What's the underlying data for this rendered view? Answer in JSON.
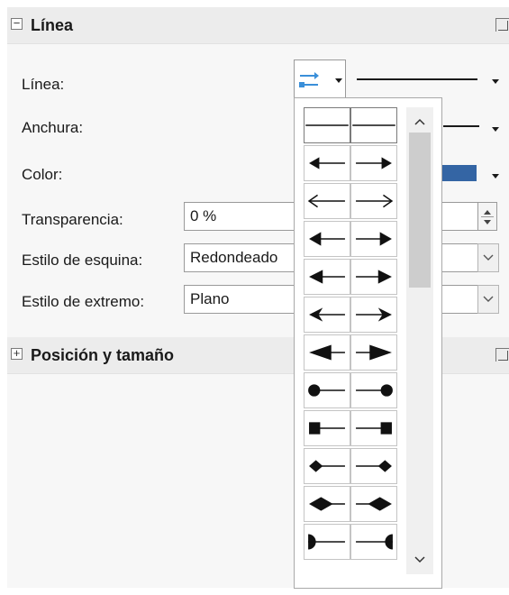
{
  "section_line": {
    "title": "Línea"
  },
  "labels": {
    "line": "Línea:",
    "width": "Anchura:",
    "color": "Color:",
    "transparency": "Transparencia:",
    "corner_style": "Estilo de esquina:",
    "cap_style": "Estilo de extremo:"
  },
  "fields": {
    "transparency": "0 %",
    "corner_style": "Redondeado",
    "cap_style": "Plano"
  },
  "colors": {
    "line_color": "#3465a4",
    "arrow_icon": "#3a8fd9"
  },
  "arrow_styles": [
    "none-left",
    "none-right",
    "arrow-left",
    "arrow-right",
    "line-arrow-left",
    "line-arrow-right",
    "arrow-short-left",
    "arrow-short-right",
    "triangle-left",
    "triangle-right",
    "concave-left",
    "concave-right",
    "large-arrow-left",
    "large-arrow-right",
    "circle-left",
    "circle-right",
    "square-left",
    "square-right",
    "diamond-left",
    "diamond-right",
    "large-diamond-left",
    "large-diamond-right",
    "half-circle-left",
    "half-circle-right"
  ],
  "section_position": {
    "title": "Posición y tamaño"
  }
}
